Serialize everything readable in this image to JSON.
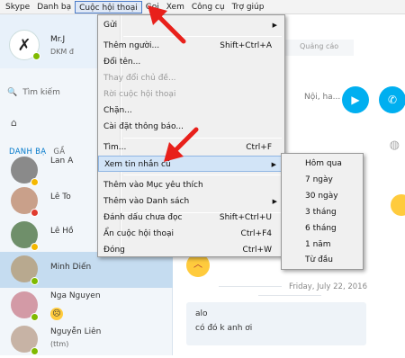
{
  "menubar": {
    "items": [
      "Skype",
      "Danh bạ",
      "Cuộc hội thoại",
      "Gọi",
      "Xem",
      "Công cụ",
      "Trợ giúp"
    ]
  },
  "profile": {
    "name": "Mr.J",
    "subtitle": "DKM đ"
  },
  "search": {
    "placeholder": "Tìm kiếm"
  },
  "tabs": {
    "contacts": "DANH BẠ",
    "recent": "GẦ"
  },
  "contacts": [
    {
      "name": "Lan A"
    },
    {
      "name": "Lê To"
    },
    {
      "name": "Lê Hồ"
    },
    {
      "name": "Minh Diến"
    },
    {
      "name": "Nga Nguyen"
    },
    {
      "name": "Nguyễn Liên",
      "sub": "(ttm)"
    }
  ],
  "conversation": {
    "ad_tab": "Quảng cáo",
    "title_fragment": "Nội, ha...",
    "date": "Friday, July 22, 2016",
    "messages": [
      "alo",
      "có đó k anh ơi"
    ]
  },
  "menu": {
    "items": [
      {
        "label": "Gửi",
        "shortcut": "",
        "submenu": true,
        "disabled": false
      },
      {
        "label": "Thêm người...",
        "shortcut": "Shift+Ctrl+A",
        "disabled": false
      },
      {
        "label": "Đổi tên...",
        "shortcut": "",
        "disabled": false
      },
      {
        "label": "Thay đổi chủ đề...",
        "shortcut": "",
        "disabled": true
      },
      {
        "label": "Rời cuộc hội thoại",
        "shortcut": "",
        "disabled": true
      },
      {
        "label": "Chặn...",
        "shortcut": "",
        "disabled": false
      },
      {
        "label": "Cài đặt thông báo...",
        "shortcut": "",
        "disabled": false
      },
      {
        "label": "Tìm...",
        "shortcut": "Ctrl+F",
        "disabled": false
      },
      {
        "label": "Xem tin nhắn cũ",
        "shortcut": "",
        "submenu": true,
        "disabled": false
      },
      {
        "label": "Thêm vào Mục yêu thích",
        "shortcut": "",
        "disabled": false
      },
      {
        "label": "Thêm vào Danh sách",
        "shortcut": "",
        "submenu": true,
        "disabled": false
      },
      {
        "label": "Đánh dấu chưa đọc",
        "shortcut": "Shift+Ctrl+U",
        "disabled": false
      },
      {
        "label": "Ẩn cuộc hội thoại",
        "shortcut": "Ctrl+F4",
        "disabled": false
      },
      {
        "label": "Đóng",
        "shortcut": "Ctrl+W",
        "disabled": false
      }
    ]
  },
  "submenu": {
    "items": [
      "Hôm qua",
      "7 ngày",
      "30 ngày",
      "3 tháng",
      "6 tháng",
      "1 năm",
      "Từ đầu"
    ]
  },
  "colors": {
    "skype_blue": "#00aff0",
    "highlight": "#d2e4f7",
    "arrow_red": "#e8201b",
    "online": "#7fba00"
  }
}
